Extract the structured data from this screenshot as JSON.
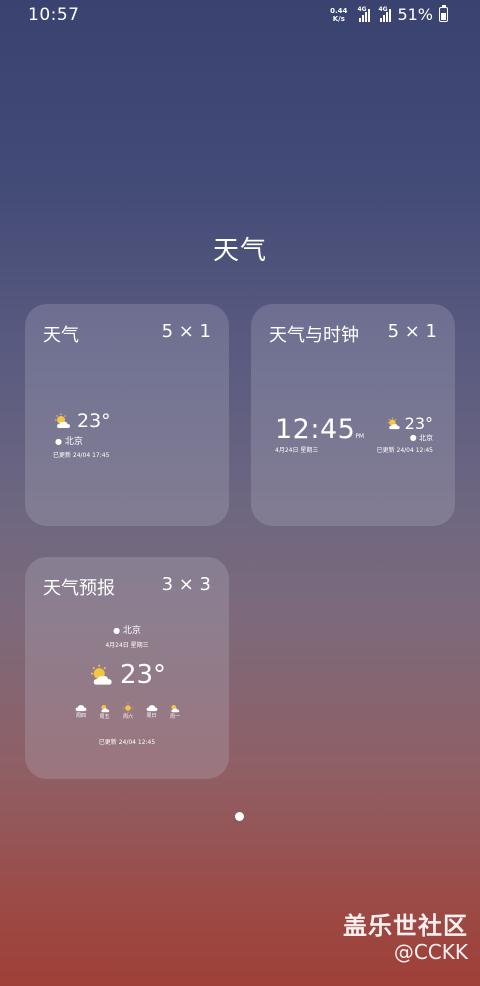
{
  "status_bar": {
    "time": "10:57",
    "net_speed_value": "0.44",
    "net_speed_unit": "K/s",
    "sim1_label": "4G",
    "sim2_label": "4G",
    "battery": "51%",
    "battery_level": 0.51
  },
  "page_title": "天气",
  "widgets": [
    {
      "name": "天气",
      "size": "5 × 1",
      "preview": {
        "temp": "23°",
        "city": "北京",
        "updated": "已更新 24/04 17:45"
      }
    },
    {
      "name": "天气与时钟",
      "size": "5 × 1",
      "preview": {
        "time": "12:45",
        "ampm": "PM",
        "date": "4月24日 星期三",
        "temp": "23°",
        "city": "北京",
        "updated": "已更新 24/04 12:45"
      }
    },
    {
      "name": "天气预报",
      "size": "3 × 3",
      "preview": {
        "city": "北京",
        "date": "4月24日 星期三",
        "temp": "23°",
        "forecast": [
          "周四",
          "周五",
          "周六",
          "周日",
          "周一"
        ],
        "updated": "已更新 24/04 12:45"
      }
    }
  ],
  "icons": {
    "partly_sunny": "partly-sunny-icon",
    "cloud": "cloud-icon",
    "sun": "sun-icon",
    "location": "location-pin-icon"
  },
  "watermark": {
    "main": "盖乐世社区",
    "sub": "@CCKK"
  },
  "colors": {
    "background_top": "#3a4370",
    "background_bottom": "#9f3f38",
    "card_fill": "rgba(200,200,215,0.22)",
    "sun": "#f5c542"
  }
}
